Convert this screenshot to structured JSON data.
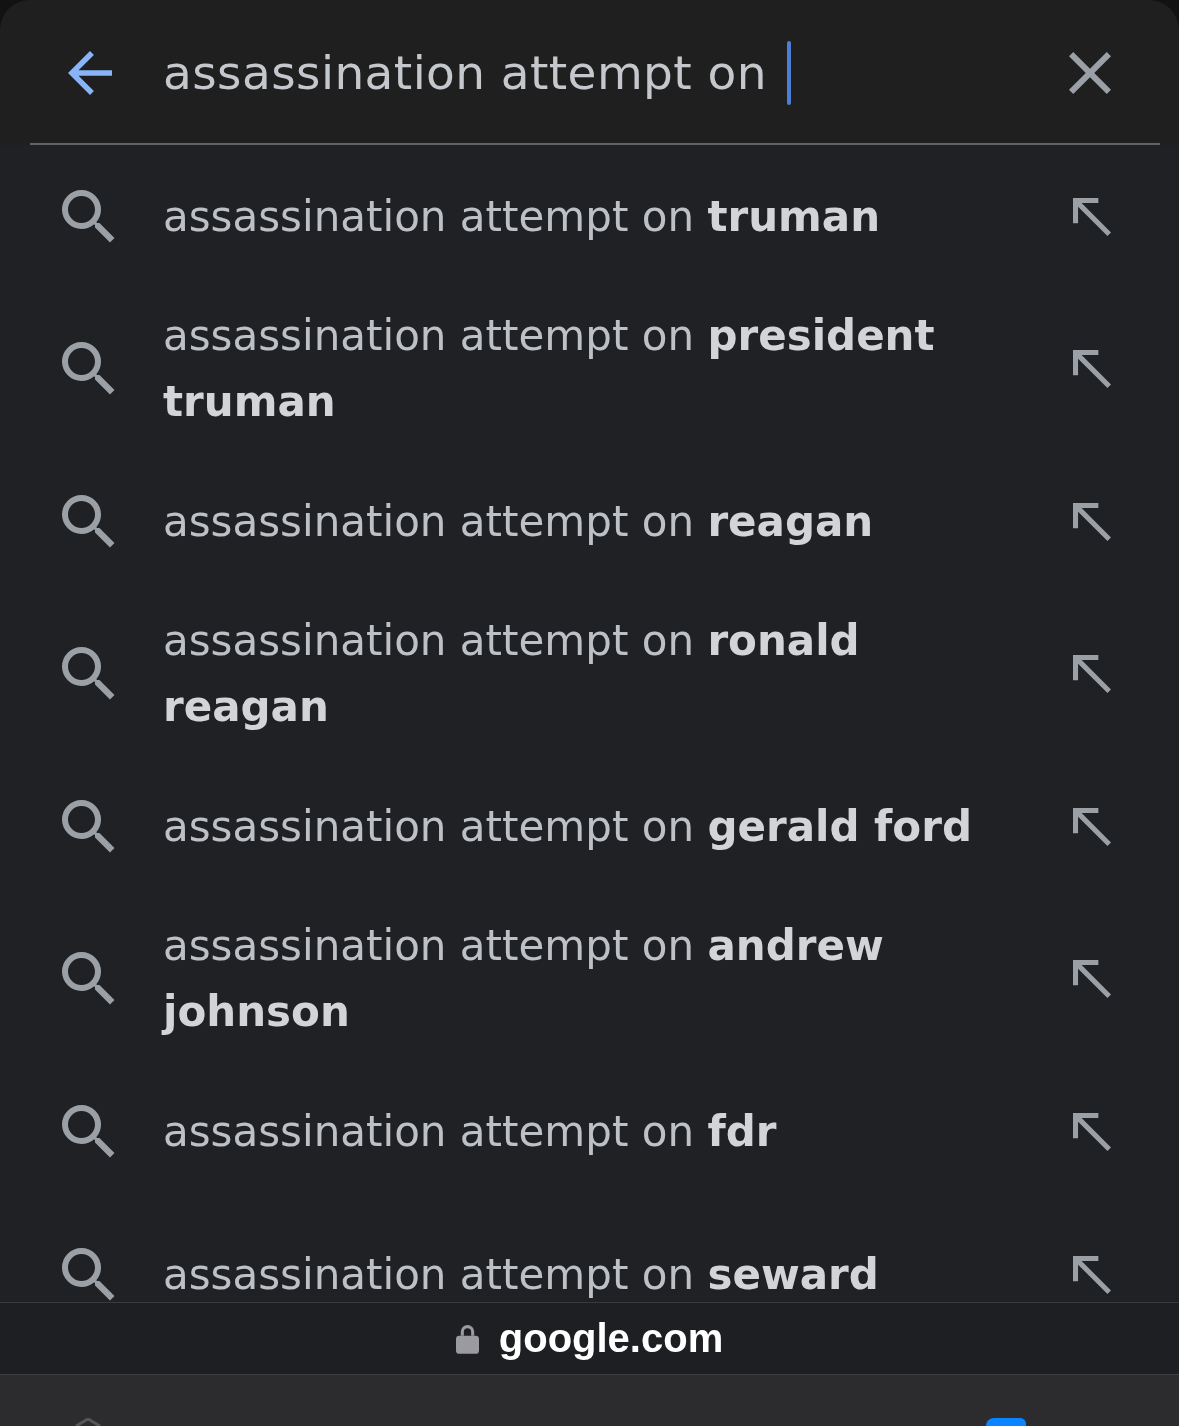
{
  "search_bar": {
    "value": "assassination attempt on",
    "focused": true
  },
  "suggestions": [
    {
      "text": "assassination attempt on **truman**"
    },
    {
      "text": "assassination attempt on **president truman**"
    },
    {
      "text": "assassination attempt on **reagan**"
    },
    {
      "text": "assassination attempt on **ronald reagan**"
    },
    {
      "text": "assassination attempt on **gerald ford**"
    },
    {
      "text": "assassination attempt on **andrew johnson**"
    },
    {
      "text": "assassination attempt on **fdr**"
    },
    {
      "text": "assassination attempt on **seward**"
    }
  ],
  "address_bar": {
    "url": "google.com",
    "secure": true
  }
}
